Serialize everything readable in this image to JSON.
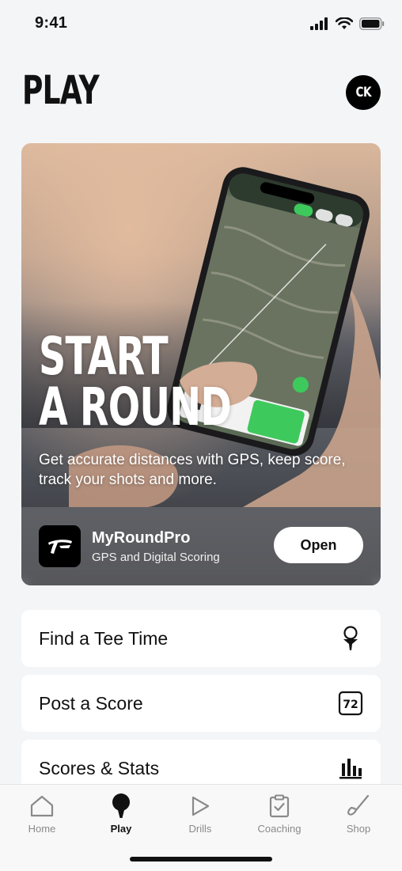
{
  "status_bar": {
    "time": "9:41"
  },
  "header": {
    "title": "PLAY",
    "avatar_initials": "CK"
  },
  "hero": {
    "headline_line1": "START",
    "headline_line2": "A ROUND",
    "description": "Get accurate distances with GPS, keep score, track your shots and more.",
    "app": {
      "name": "MyRoundPro",
      "subtitle": "GPS and Digital Scoring",
      "open_label": "Open"
    }
  },
  "menu": [
    {
      "label": "Find a Tee Time",
      "icon": "golf-tee-icon"
    },
    {
      "label": "Post a Score",
      "icon": "scorecard-icon",
      "icon_text": "72"
    },
    {
      "label": "Scores & Stats",
      "icon": "bar-chart-icon"
    }
  ],
  "tabs": [
    {
      "label": "Home",
      "icon": "home-icon",
      "active": false
    },
    {
      "label": "Play",
      "icon": "golf-ball-tee-icon",
      "active": true
    },
    {
      "label": "Drills",
      "icon": "play-icon",
      "active": false
    },
    {
      "label": "Coaching",
      "icon": "clipboard-check-icon",
      "active": false
    },
    {
      "label": "Shop",
      "icon": "golf-club-icon",
      "active": false
    }
  ],
  "colors": {
    "accent": "#3ec95c",
    "background": "#f4f5f7",
    "primary_text": "#111111",
    "inactive_tab": "#8a8a8a"
  }
}
